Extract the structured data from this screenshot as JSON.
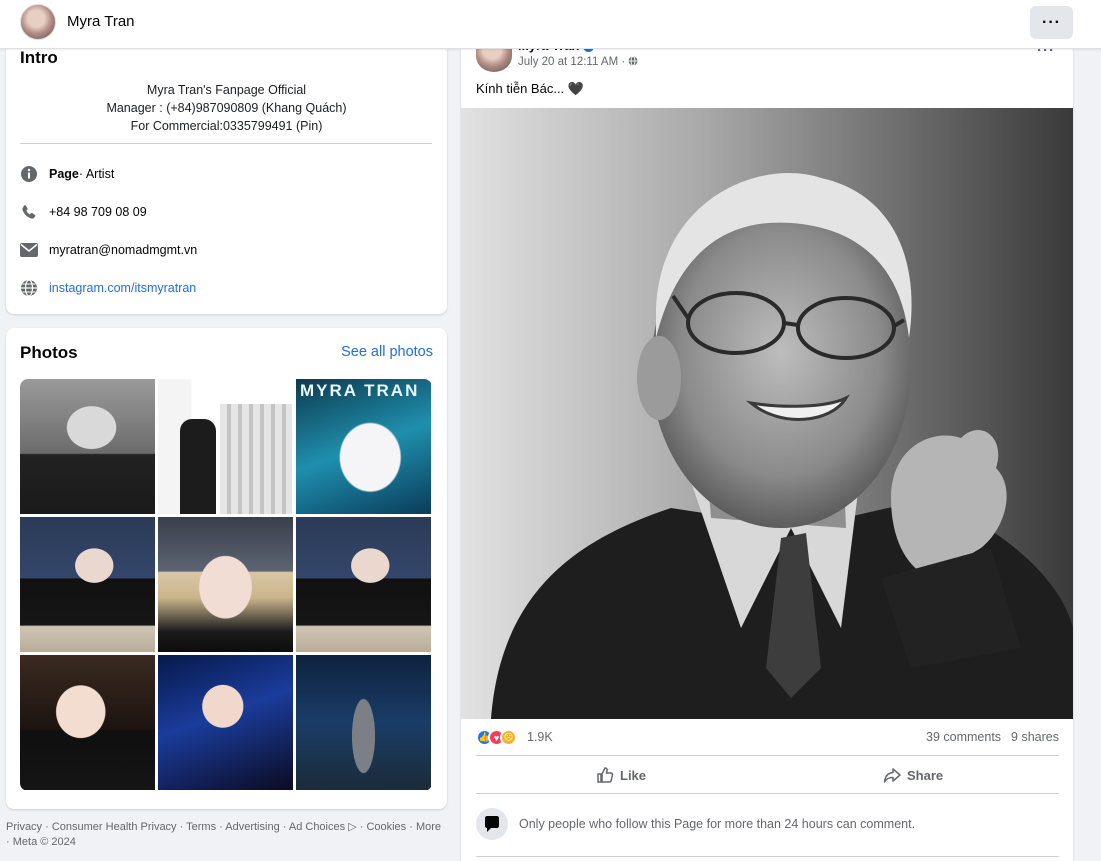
{
  "header": {
    "page_name": "Myra Tran",
    "more_icon": "more-horizontal-icon"
  },
  "intro": {
    "title": "Intro",
    "bio_lines": [
      "Myra Tran's Fanpage Official",
      "Manager : (+84)987090809 (Khang Quách)",
      "For Commercial:0335799491 (Pin)"
    ],
    "details": {
      "page_label": "Page",
      "page_category": " · Artist",
      "phone": "+84 98 709 08 09",
      "email": "myratran@nomadmgmt.vn",
      "website": "instagram.com/itsmyratran"
    }
  },
  "photos": {
    "title": "Photos",
    "see_all": "See all photos",
    "tile_logo_text": "MYRA TRAN"
  },
  "footer": {
    "links": [
      "Privacy",
      "Consumer Health Privacy",
      "Terms",
      "Advertising",
      "Ad Choices",
      "Cookies",
      "More"
    ],
    "copyright": "Meta © 2024"
  },
  "post": {
    "author": "Myra Tran",
    "timestamp": "July 20 at 12:11 AM",
    "audience_icon": "globe-icon",
    "caption": "Kính tiễn Bác... 🖤",
    "reactions": {
      "icons": [
        "like",
        "love",
        "sad"
      ],
      "count": "1.9K",
      "comments": "39 comments",
      "shares": "9 shares"
    },
    "actions": {
      "like": "Like",
      "share": "Share"
    },
    "comment_notice": "Only people who follow this Page for more than 24 hours can comment."
  },
  "colors": {
    "link": "#216fdb",
    "background": "#f0f2f5",
    "secondary_text": "#65676b"
  }
}
